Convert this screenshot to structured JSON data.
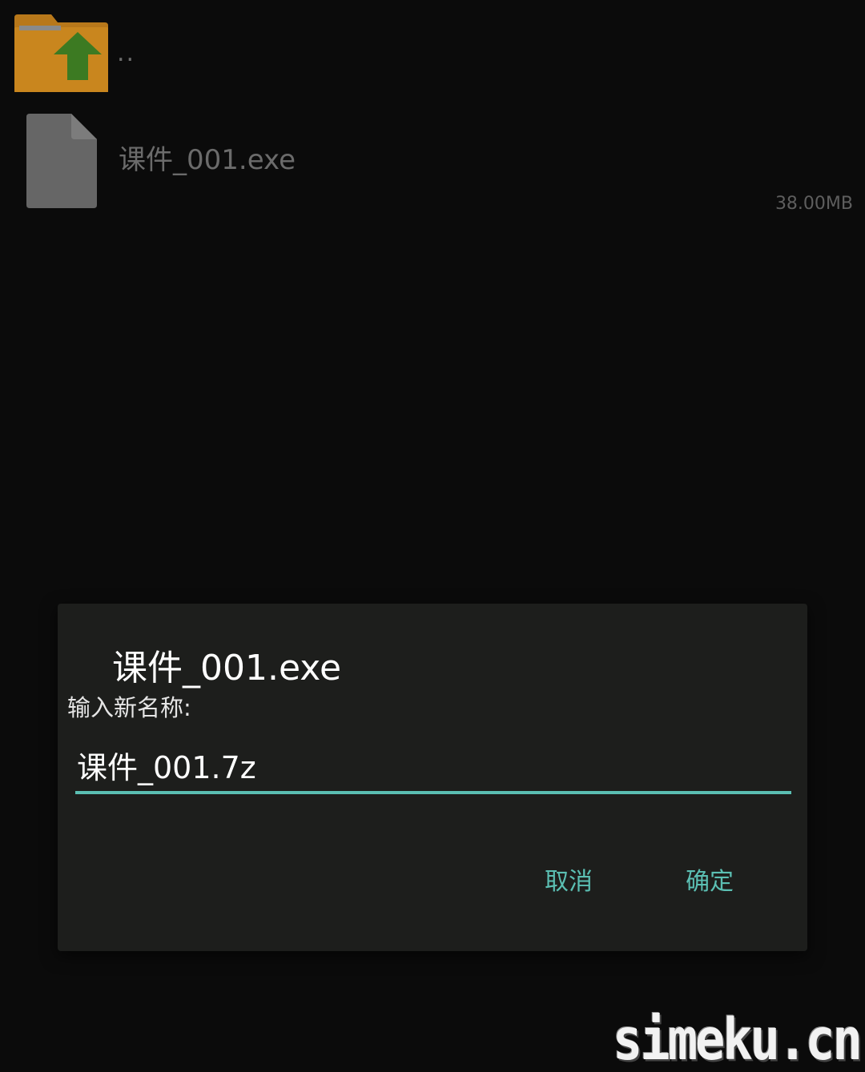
{
  "file_list": {
    "parent_row": {
      "label": "..",
      "icon": "folder-up-icon"
    },
    "files": [
      {
        "name": "课件_001.exe",
        "size": "38.00MB",
        "icon": "file-icon"
      }
    ]
  },
  "rename_dialog": {
    "title": "课件_001.exe",
    "prompt": "输入新名称:",
    "input_value": "课件_001.7z",
    "cancel_label": "取消",
    "ok_label": "确定"
  },
  "watermark": {
    "text": "simeku.cn"
  },
  "colors": {
    "accent": "#5bbfb3",
    "dialog_bg": "#1d1e1c",
    "folder": "#c9861e",
    "arrow": "#3c7a22",
    "file_icon": "#6a6a6a"
  }
}
